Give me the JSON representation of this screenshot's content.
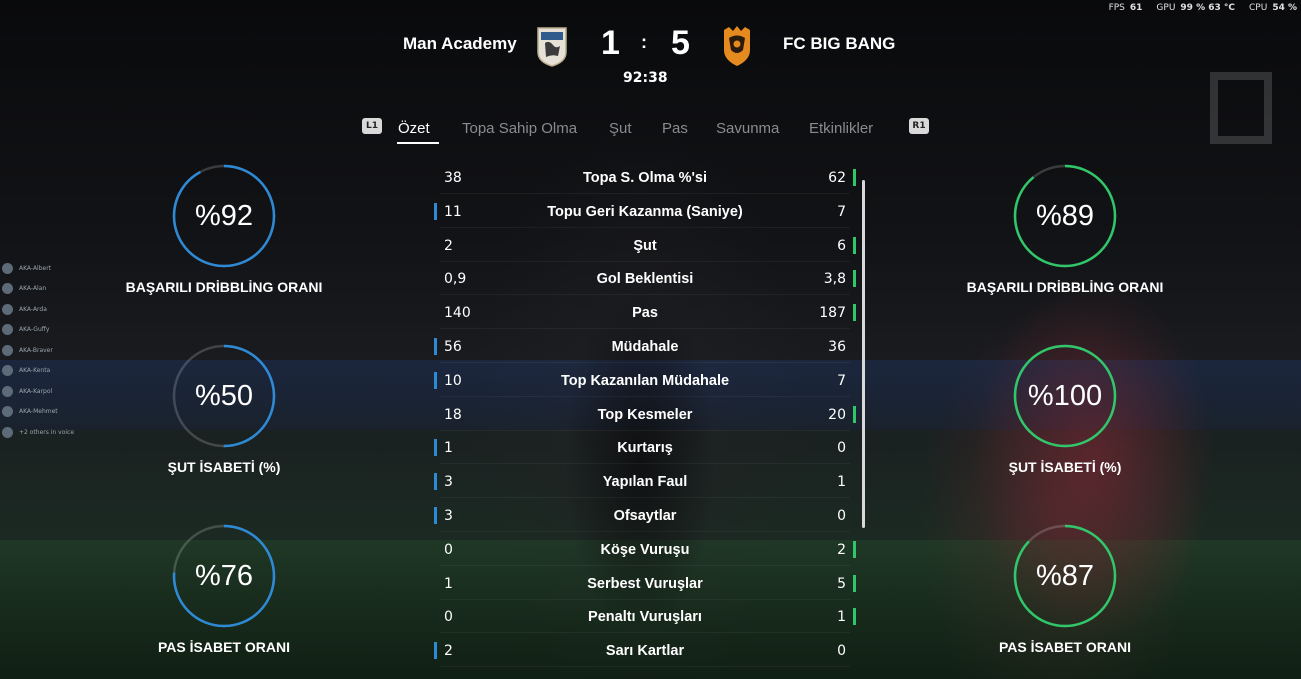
{
  "perf": {
    "fps_label": "FPS",
    "fps_value": "61",
    "gpu_label": "GPU",
    "gpu_value": "99 % 63 °C",
    "cpu_label": "CPU",
    "cpu_value": "54 %"
  },
  "match": {
    "home_team": "Man Academy",
    "away_team": "FC BIG BANG",
    "home_score": "1",
    "separator": ":",
    "away_score": "5",
    "clock": "92:38",
    "home_color": "#2d8ad6",
    "away_color": "#30c76a"
  },
  "tabs": {
    "left_button": "L1",
    "right_button": "R1",
    "items": [
      "Özet",
      "Topa Sahip Olma",
      "Şut",
      "Pas",
      "Savunma",
      "Etkinlikler"
    ],
    "active": "Özet"
  },
  "rings": {
    "home": [
      {
        "value": "%92",
        "label": "BAŞARILI DRİBBLİNG ORANI",
        "percent": 92
      },
      {
        "value": "%50",
        "label": "ŞUT İSABETİ (%)",
        "percent": 50
      },
      {
        "value": "%76",
        "label": "PAS İSABET ORANI",
        "percent": 76
      }
    ],
    "away": [
      {
        "value": "%89",
        "label": "BAŞARILI DRİBBLİNG ORANI",
        "percent": 89
      },
      {
        "value": "%100",
        "label": "ŞUT İSABETİ (%)",
        "percent": 100
      },
      {
        "value": "%87",
        "label": "PAS İSABET ORANI",
        "percent": 87
      }
    ]
  },
  "stats": [
    {
      "name": "Topa S. Olma %'si",
      "home": "38",
      "away": "62",
      "leader": "away"
    },
    {
      "name": "Topu Geri Kazanma (Saniye)",
      "home": "11",
      "away": "7",
      "leader": "home"
    },
    {
      "name": "Şut",
      "home": "2",
      "away": "6",
      "leader": "away"
    },
    {
      "name": "Gol Beklentisi",
      "home": "0,9",
      "away": "3,8",
      "leader": "away"
    },
    {
      "name": "Pas",
      "home": "140",
      "away": "187",
      "leader": "away"
    },
    {
      "name": "Müdahale",
      "home": "56",
      "away": "36",
      "leader": "home"
    },
    {
      "name": "Top Kazanılan Müdahale",
      "home": "10",
      "away": "7",
      "leader": "home"
    },
    {
      "name": "Top Kesmeler",
      "home": "18",
      "away": "20",
      "leader": "away"
    },
    {
      "name": "Kurtarış",
      "home": "1",
      "away": "0",
      "leader": "home"
    },
    {
      "name": "Yapılan Faul",
      "home": "3",
      "away": "1",
      "leader": "home"
    },
    {
      "name": "Ofsaytlar",
      "home": "3",
      "away": "0",
      "leader": "home"
    },
    {
      "name": "Köşe Vuruşu",
      "home": "0",
      "away": "2",
      "leader": "away"
    },
    {
      "name": "Serbest Vuruşlar",
      "home": "1",
      "away": "5",
      "leader": "away"
    },
    {
      "name": "Penaltı Vuruşları",
      "home": "0",
      "away": "1",
      "leader": "away"
    },
    {
      "name": "Sarı Kartlar",
      "home": "2",
      "away": "0",
      "leader": "home"
    }
  ],
  "chat": [
    "AKA-Albert",
    "AKA-Alan",
    "AKA-Arda",
    "AKA-Guffy",
    "AKA-Braver",
    "AKA-Kenta",
    "AKA-Karpol",
    "AKA-Mehmet",
    "+2 others in voice"
  ]
}
